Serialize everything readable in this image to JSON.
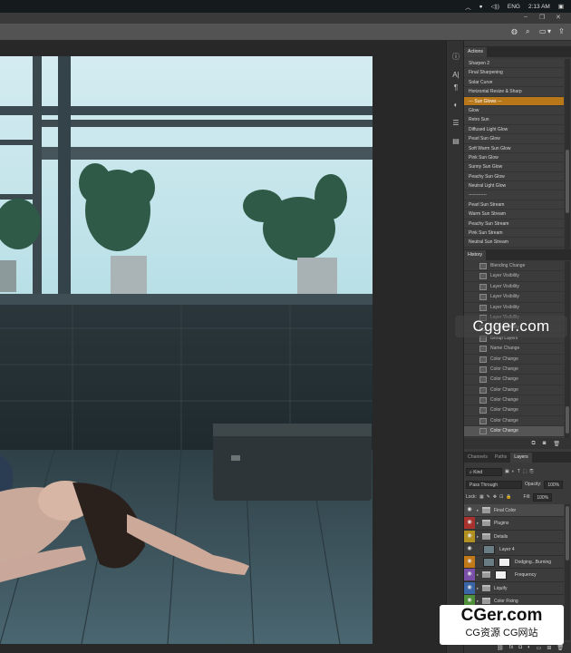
{
  "taskbar": {
    "language": "ENG",
    "time": "2:13 AM"
  },
  "panels": {
    "actions": {
      "tab": "Actions",
      "items": [
        "Sharpen 2",
        "Final Sharpening",
        "Solar Curve",
        "Horizontal Resize & Sharp",
        "--- Sun Glows ---",
        "Glow",
        "Retro Sun",
        "Diffused Light Glow",
        "Pearl Sun Glow",
        "Soft Warm Sun Glow",
        "Pink Sun Glow",
        "Sunny Sun Glow",
        "Peachy Sun Glow",
        "Neutral Light Glow",
        "------------",
        "Pearl Sun Stream",
        "Warm Sun Stream",
        "Peachy Sun Stream",
        "Pink Sun Stream",
        "Neutral Sun Stream"
      ],
      "selected_index": 4
    },
    "history": {
      "tab": "History",
      "items": [
        "Blending Change",
        "Layer Visibility",
        "Layer Visibility",
        "Layer Visibility",
        "Layer Visibility",
        "Layer Visibility",
        "Layer Visibility",
        "Group Layers",
        "Name Change",
        "Color Change",
        "Color Change",
        "Color Change",
        "Color Change",
        "Color Change",
        "Color Change",
        "Color Change",
        "Color Change"
      ],
      "selected_index": 16
    },
    "layers": {
      "tabs": [
        "Channels",
        "Paths",
        "Layers"
      ],
      "active_tab": "Layers",
      "filter": "Kind",
      "blend_mode": "Pass Through",
      "opacity_label": "Opacity:",
      "opacity": "100%",
      "lock_label": "Lock:",
      "fill_label": "Fill:",
      "fill": "100%",
      "items": [
        {
          "name": "Final Color",
          "eye_color": "none",
          "type": "folder"
        },
        {
          "name": "Plugins",
          "eye_color": "#a8332e",
          "type": "folder"
        },
        {
          "name": "Details",
          "eye_color": "#b09020",
          "type": "folder"
        },
        {
          "name": "Layer 4",
          "eye_color": "none",
          "type": "layer"
        },
        {
          "name": "Dodging...Burning",
          "eye_color": "#c07818",
          "type": "layer-mask"
        },
        {
          "name": "Frequency",
          "eye_color": "#7a4fa8",
          "type": "folder-mask"
        },
        {
          "name": "Liquify",
          "eye_color": "#3a66a8",
          "type": "folder"
        },
        {
          "name": "Color Fixing",
          "eye_color": "#4f8f3a",
          "type": "folder"
        }
      ],
      "selected_index": 0
    }
  },
  "watermarks": {
    "overlay": "Cgger.com",
    "badge_main": "CGer.com",
    "badge_sub": "CG资源 CG网站"
  },
  "colors": {
    "accent_selection": "#b8781a",
    "ui_dark": "#282828",
    "panel": "#3a3a3a"
  }
}
